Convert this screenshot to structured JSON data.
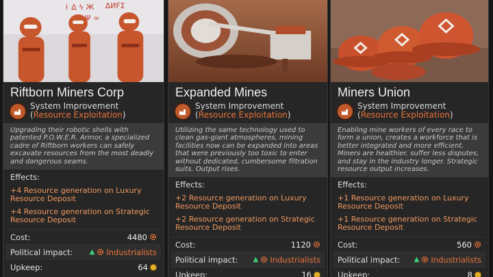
{
  "accent_color": "#e8733a",
  "cards": [
    {
      "title": "Riftborn Miners Corp",
      "type_prefix": "System Improvement (",
      "type_category": "Resource Exploitation",
      "type_suffix": ")",
      "description": "Upgrading their robotic shells with patented P.O.W.E.R. Armor, a specialized cadre of Riftborn workers can safely excavate resources from the most deadly and dangerous seams.",
      "effects_label": "Effects:",
      "effects": [
        "+4 Resource generation on Luxury Resource Deposit",
        "+4 Resource generation on Strategic Resource Deposit"
      ],
      "cost_label": "Cost:",
      "cost_value": "4480",
      "political_label": "Political impact:",
      "political_value": "Industrialists",
      "upkeep_label": "Upkeep:",
      "upkeep_value": "64"
    },
    {
      "title": "Expanded Mines",
      "type_prefix": "System Improvement (",
      "type_category": "Resource Exploitation",
      "type_suffix": ")",
      "description": "Utilizing the same technology used to clean gas-giant atmospheres, mining facilities now can be expanded into areas that were previously too toxic to enter without dedicated, cumbersome filtration suits. Output rises.",
      "effects_label": "Effects:",
      "effects": [
        "+2 Resource generation on Luxury Resource Deposit",
        "+2 Resource generation on Strategic Resource Deposit"
      ],
      "cost_label": "Cost:",
      "cost_value": "1120",
      "political_label": "Political impact:",
      "political_value": "Industrialists",
      "upkeep_label": "Upkeep:",
      "upkeep_value": "16"
    },
    {
      "title": "Miners Union",
      "type_prefix": "System Improvement (",
      "type_category": "Resource Exploitation",
      "type_suffix": ")",
      "description": "Enabling mine workers of every race to form a union, creates a workforce that is better integrated and more efficient. Miners are healthier, suffer less disputes, and stay in the industry longer. Strategic resource output increases.",
      "effects_label": "Effects:",
      "effects": [
        "+1 Resource generation on Luxury Resource Deposit",
        "+1 Resource generation on Strategic Resource Deposit"
      ],
      "cost_label": "Cost:",
      "cost_value": "560",
      "political_label": "Political impact:",
      "political_value": "Industrialists",
      "upkeep_label": "Upkeep:",
      "upkeep_value": "8"
    }
  ]
}
